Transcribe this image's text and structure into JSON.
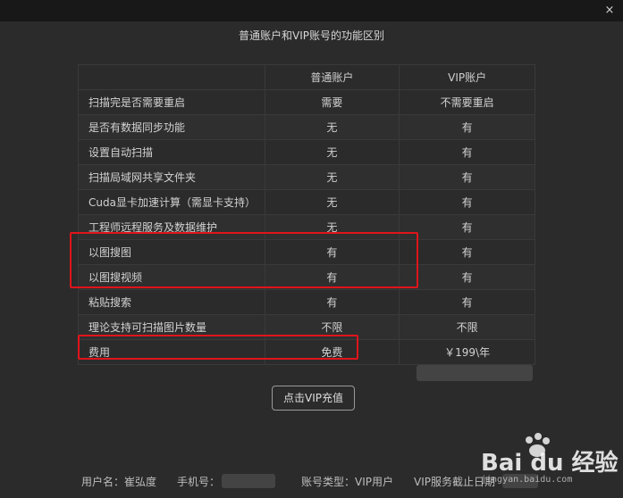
{
  "window": {
    "close_glyph": "×"
  },
  "dialog": {
    "title": "普通账户和VIP账号的功能区别"
  },
  "table": {
    "headers": [
      "",
      "普通账户",
      "VIP账户"
    ],
    "rows": [
      {
        "feature": "扫描完是否需要重启",
        "normal": "需要",
        "vip": "不需要重启"
      },
      {
        "feature": "是否有数据同步功能",
        "normal": "无",
        "vip": "有"
      },
      {
        "feature": "设置自动扫描",
        "normal": "无",
        "vip": "有"
      },
      {
        "feature": "扫描局域网共享文件夹",
        "normal": "无",
        "vip": "有"
      },
      {
        "feature": "Cuda显卡加速计算（需显卡支持）",
        "normal": "无",
        "vip": "有"
      },
      {
        "feature": "工程师远程服务及数据维护",
        "normal": "无",
        "vip": "有"
      },
      {
        "feature": "以图搜图",
        "normal": "有",
        "vip": "有"
      },
      {
        "feature": "以图搜视频",
        "normal": "有",
        "vip": "有"
      },
      {
        "feature": "粘贴搜索",
        "normal": "有",
        "vip": "有"
      },
      {
        "feature": "理论支持可扫描图片数量",
        "normal": "不限",
        "vip": "不限"
      },
      {
        "feature": "费用",
        "normal": "免费",
        "vip": "￥199\\年"
      }
    ]
  },
  "buttons": {
    "vip_recharge": "点击VIP充值"
  },
  "footer": {
    "username": "用户名：崔弘度",
    "phone_label": "手机号：",
    "account_type": "账号类型：VIP用户",
    "vip_expiry": "VIP服务截止日期"
  },
  "watermark": {
    "brand": "Bai du 经验",
    "sub": "jingyan.baidu.com"
  },
  "colors": {
    "background": "#2b2b2b",
    "highlight": "#e0141b",
    "text": "#d2d2d2"
  }
}
